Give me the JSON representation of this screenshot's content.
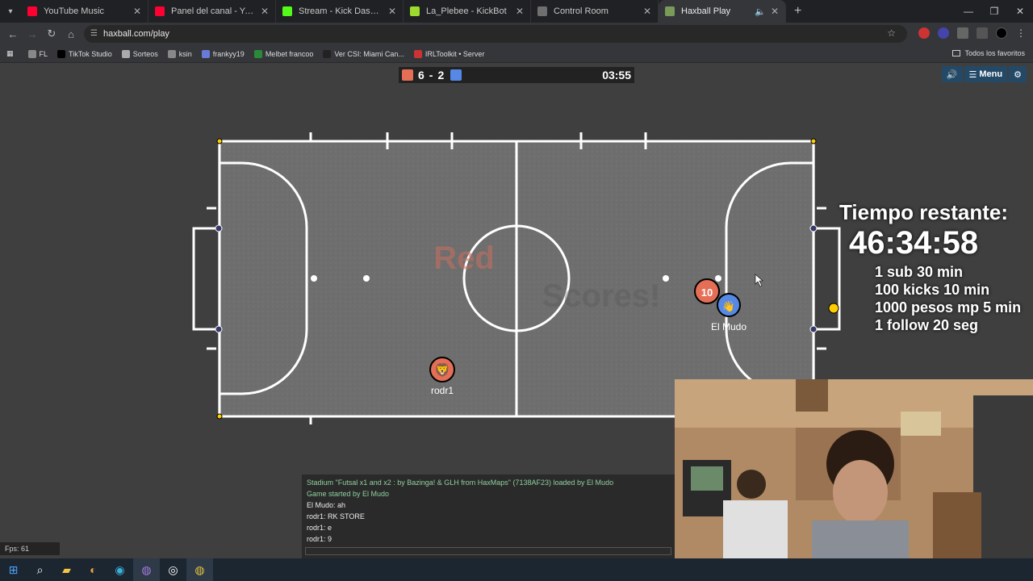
{
  "tabs": [
    {
      "title": "YouTube Music",
      "color": "#ff0033"
    },
    {
      "title": "Panel del canal - YouTube Studi",
      "color": "#ff0033"
    },
    {
      "title": "Stream - Kick Dashboard",
      "color": "#53fc18"
    },
    {
      "title": "La_Plebee - KickBot",
      "color": "#9ddb2d"
    },
    {
      "title": "Control Room",
      "color": "#6f6f6f"
    },
    {
      "title": "Haxball Play",
      "color": "#7a9a5a"
    }
  ],
  "address": {
    "url": "haxball.com/play"
  },
  "bookmarks": [
    "FL",
    "TikTok Studio",
    "Sorteos",
    "ksin",
    "frankyy19",
    "Melbet francoo",
    "Ver CSI: Miami Can...",
    "IRLToolkit • Server"
  ],
  "bookmarks_all": "Todos los favoritos",
  "game": {
    "score_red": "6",
    "score_sep": "-",
    "score_blue": "2",
    "time": "03:55",
    "menu_label": "Menu",
    "goal_text_1": "Red",
    "goal_text_2": "Scores!",
    "player_red_label": "rodr1",
    "player_blue_label": "El Mudo",
    "player_red_number": "10",
    "colors": {
      "red": "#e56e56",
      "blue": "#5689e5",
      "ball": "#ffcc00"
    }
  },
  "overlay": {
    "title": "Tiempo restante:",
    "countdown": "46:34:58",
    "rules": [
      "1 sub 30 min",
      "100 kicks 10 min",
      "1000 pesos mp 5 min",
      "1 follow 20 seg"
    ]
  },
  "chat": [
    {
      "text": "Stadium \"Futsal x1 and x2 : by Bazinga! & GLH from HaxMaps\" (7138AF23) loaded by El Mudo",
      "system": true
    },
    {
      "text": "Game started by El Mudo",
      "system": true
    },
    {
      "text": "El Mudo: ah",
      "system": false
    },
    {
      "text": "rodr1: RK STORE",
      "system": false
    },
    {
      "text": "rodr1: e",
      "system": false
    },
    {
      "text": "rodr1: 9",
      "system": false
    }
  ],
  "fps": "Fps: 61"
}
